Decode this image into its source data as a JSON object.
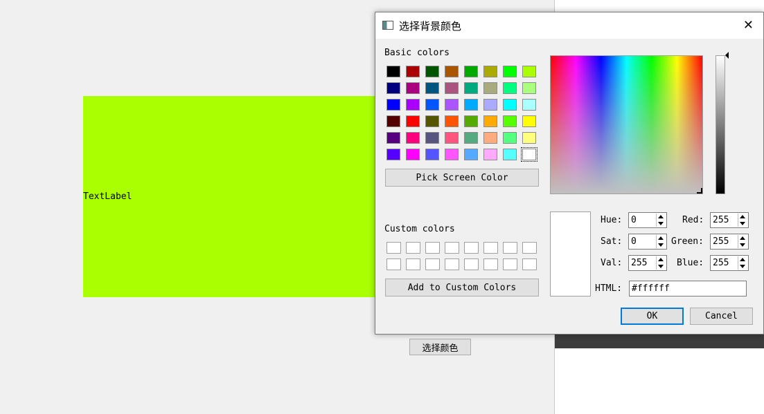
{
  "main": {
    "text_label": "TextLabel",
    "choose_button": "选择颜色",
    "area_color": "#aaff00"
  },
  "dialog": {
    "title": "选择背景颜色",
    "basic_colors_label": "Basic colors",
    "basic_colors": [
      "#000000",
      "#aa0000",
      "#005500",
      "#aa5500",
      "#00aa00",
      "#aaaa00",
      "#00ff00",
      "#aaff00",
      "#00007f",
      "#aa007f",
      "#00557f",
      "#aa557f",
      "#00aa7f",
      "#aaaa7f",
      "#00ff7f",
      "#aaff7f",
      "#0000ff",
      "#aa00ff",
      "#0055ff",
      "#aa55ff",
      "#00aaff",
      "#aaaaff",
      "#00ffff",
      "#aaffff",
      "#550000",
      "#ff0000",
      "#555500",
      "#ff5500",
      "#55aa00",
      "#ffaa00",
      "#55ff00",
      "#ffff00",
      "#55007f",
      "#ff007f",
      "#55557f",
      "#ff557f",
      "#55aa7f",
      "#ffaa7f",
      "#55ff7f",
      "#ffff7f",
      "#5500ff",
      "#ff00ff",
      "#5555ff",
      "#ff55ff",
      "#55aaff",
      "#ffaaff",
      "#55ffff",
      "#ffffff"
    ],
    "pick_screen_color": "Pick Screen Color",
    "custom_colors_label": "Custom colors",
    "add_custom": "Add to Custom Colors",
    "fields": {
      "hue": {
        "label": "Hue:",
        "value": "0"
      },
      "sat": {
        "label": "Sat:",
        "value": "0"
      },
      "val": {
        "label": "Val:",
        "value": "255"
      },
      "red": {
        "label": "Red:",
        "value": "255"
      },
      "green": {
        "label": "Green:",
        "value": "255"
      },
      "blue": {
        "label": "Blue:",
        "value": "255"
      }
    },
    "html_label": "HTML:",
    "html_value": "#ffffff",
    "ok": "OK",
    "cancel": "Cancel"
  }
}
